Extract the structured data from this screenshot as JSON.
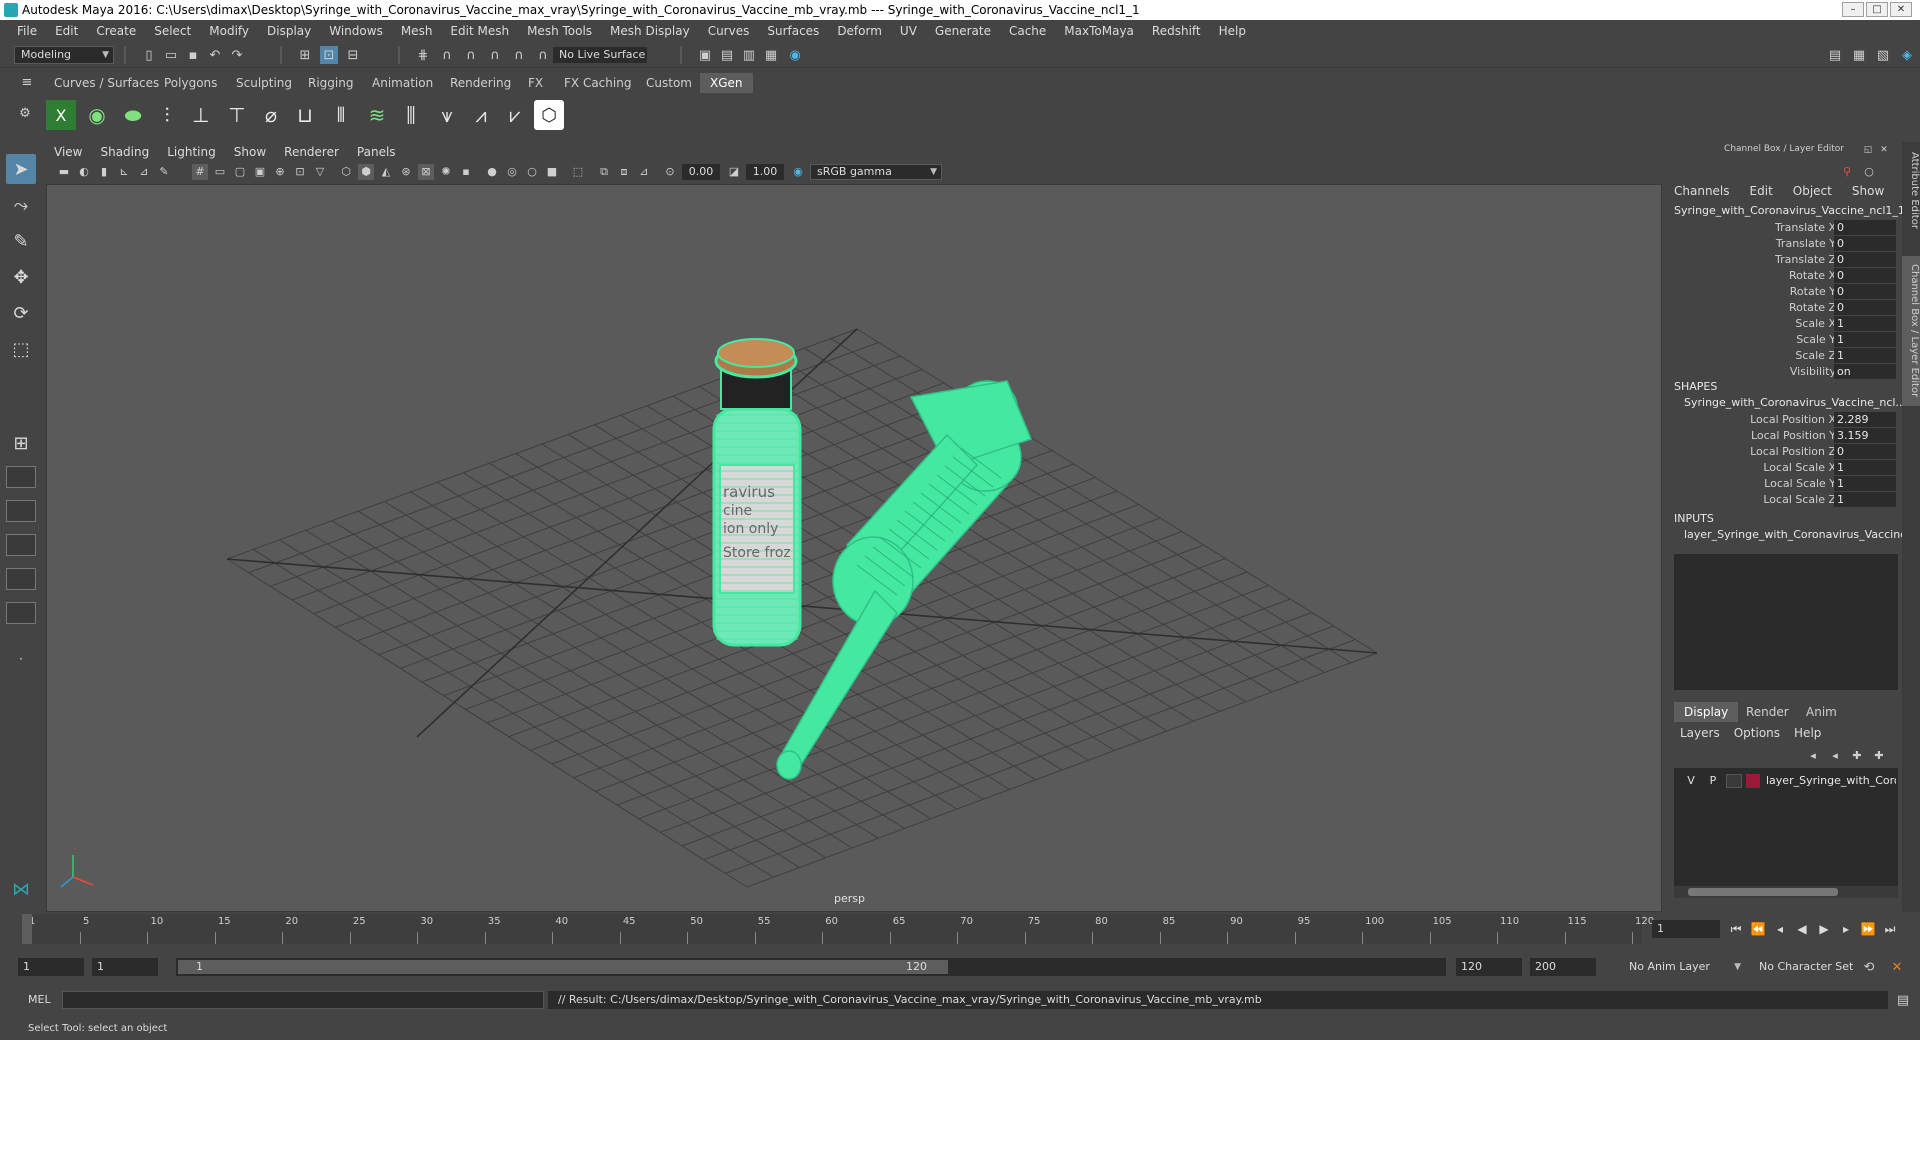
{
  "window": {
    "title": "Autodesk Maya 2016: C:\\Users\\dimax\\Desktop\\Syringe_with_Coronavirus_Vaccine_max_vray\\Syringe_with_Coronavirus_Vaccine_mb_vray.mb   ---   Syringe_with_Coronavirus_Vaccine_ncl1_1",
    "controls": [
      "–",
      "□",
      "✕"
    ]
  },
  "menubar": [
    "File",
    "Edit",
    "Create",
    "Select",
    "Modify",
    "Display",
    "Windows",
    "Mesh",
    "Edit Mesh",
    "Mesh Tools",
    "Mesh Display",
    "Curves",
    "Surfaces",
    "Deform",
    "UV",
    "Generate",
    "Cache",
    "MaxToMaya",
    "Redshift",
    "Help"
  ],
  "statusline": {
    "mode": "Modeling",
    "live_surface": "No Live Surface"
  },
  "shelf": {
    "tabs": [
      "Curves / Surfaces",
      "Polygons",
      "Sculpting",
      "Rigging",
      "Animation",
      "Rendering",
      "FX",
      "FX Caching",
      "Custom",
      "XGen"
    ],
    "active_tab": "XGen"
  },
  "viewport": {
    "menu": [
      "View",
      "Shading",
      "Lighting",
      "Show",
      "Renderer",
      "Panels"
    ],
    "exposure": "0.00",
    "gamma": "1.00",
    "color_space": "sRGB gamma",
    "camera_label": "persp",
    "label_text": [
      "ravirus",
      "cine",
      "ion only",
      "Store froz"
    ]
  },
  "channelbox": {
    "title": "Channel Box / Layer Editor",
    "menu": [
      "Channels",
      "Edit",
      "Object",
      "Show"
    ],
    "object_name": "Syringe_with_Coronavirus_Vaccine_ncl1_1",
    "channels": [
      {
        "label": "Translate X",
        "value": "0"
      },
      {
        "label": "Translate Y",
        "value": "0"
      },
      {
        "label": "Translate Z",
        "value": "0"
      },
      {
        "label": "Rotate X",
        "value": "0"
      },
      {
        "label": "Rotate Y",
        "value": "0"
      },
      {
        "label": "Rotate Z",
        "value": "0"
      },
      {
        "label": "Scale X",
        "value": "1"
      },
      {
        "label": "Scale Y",
        "value": "1"
      },
      {
        "label": "Scale Z",
        "value": "1"
      },
      {
        "label": "Visibility",
        "value": "on"
      }
    ],
    "shapes_header": "SHAPES",
    "shape_name": "Syringe_with_Coronavirus_Vaccine_ncl...",
    "shape_channels": [
      {
        "label": "Local Position X",
        "value": "2.289"
      },
      {
        "label": "Local Position Y",
        "value": "3.159"
      },
      {
        "label": "Local Position Z",
        "value": "0"
      },
      {
        "label": "Local Scale X",
        "value": "1"
      },
      {
        "label": "Local Scale Y",
        "value": "1"
      },
      {
        "label": "Local Scale Z",
        "value": "1"
      }
    ],
    "inputs_header": "INPUTS",
    "input_name": "layer_Syringe_with_Coronavirus_Vaccine"
  },
  "layer_editor": {
    "tabs": [
      "Display",
      "Render",
      "Anim"
    ],
    "active_tab": "Display",
    "menu": [
      "Layers",
      "Options",
      "Help"
    ],
    "layer": {
      "v": "V",
      "p": "P",
      "name": "layer_Syringe_with_Coro",
      "color": "#9b1838"
    }
  },
  "side_tabs": [
    "Attribute Editor",
    "Channel Box / Layer Editor"
  ],
  "timeline": {
    "ticks": [
      "1",
      "5",
      "10",
      "15",
      "20",
      "25",
      "30",
      "35",
      "40",
      "45",
      "50",
      "55",
      "60",
      "65",
      "70",
      "75",
      "80",
      "85",
      "90",
      "95",
      "100",
      "105",
      "110",
      "115",
      "120"
    ],
    "current_frame": "1",
    "start": 1,
    "end": 120
  },
  "range": {
    "start_field": "1",
    "start_field2": "1",
    "slider_start": "1",
    "slider_end": "120",
    "end_field": "120",
    "end_field2": "200",
    "anim_layer": "No Anim Layer",
    "char_set": "No Character Set"
  },
  "command": {
    "label": "MEL",
    "result": "// Result: C:/Users/dimax/Desktop/Syringe_with_Coronavirus_Vaccine_max_vray/Syringe_with_Coronavirus_Vaccine_mb_vray.mb"
  },
  "helpline": "Select Tool: select an object",
  "colors": {
    "ui_bg": "#444444",
    "viewport_bg": "#5a5a5a",
    "wireframe": "#45e8a0",
    "active_tab": "#5d5d5d",
    "tool_active": "#5285a6"
  }
}
